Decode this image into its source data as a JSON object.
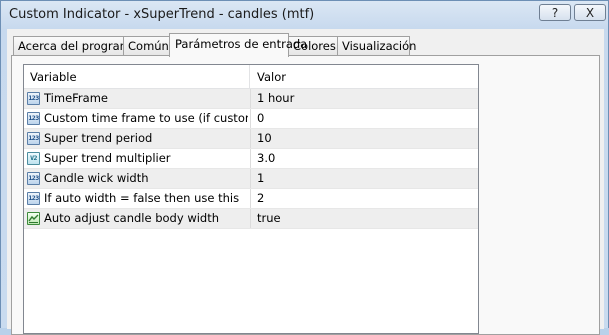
{
  "window": {
    "title": "Custom Indicator - xSuperTrend - candles (mtf)",
    "help_label": "?",
    "close_label": "X"
  },
  "tabs": [
    {
      "label": "Acerca del programa"
    },
    {
      "label": "Común"
    },
    {
      "label": "Parámetros de entrada",
      "active": true
    },
    {
      "label": "Colores"
    },
    {
      "label": "Visualización"
    }
  ],
  "grid": {
    "headers": {
      "variable": "Variable",
      "value": "Valor"
    },
    "rows": [
      {
        "icon": "integer-icon",
        "icon_text": "123",
        "variable": "TimeFrame",
        "value": "1 hour"
      },
      {
        "icon": "integer-icon",
        "icon_text": "123",
        "variable": "Custom time frame to use (if custom time ...",
        "value": "0"
      },
      {
        "icon": "integer-icon",
        "icon_text": "123",
        "variable": "Super trend period",
        "value": "10"
      },
      {
        "icon": "double-icon",
        "icon_text": "V2",
        "variable": "Super trend multiplier",
        "value": "3.0"
      },
      {
        "icon": "integer-icon",
        "icon_text": "123",
        "variable": "Candle wick width",
        "value": "1"
      },
      {
        "icon": "integer-icon",
        "icon_text": "123",
        "variable": "If auto width = false then use this",
        "value": "2"
      },
      {
        "icon": "boolean-icon",
        "icon_text": "",
        "variable": "Auto adjust candle body width",
        "value": "true"
      }
    ]
  }
}
